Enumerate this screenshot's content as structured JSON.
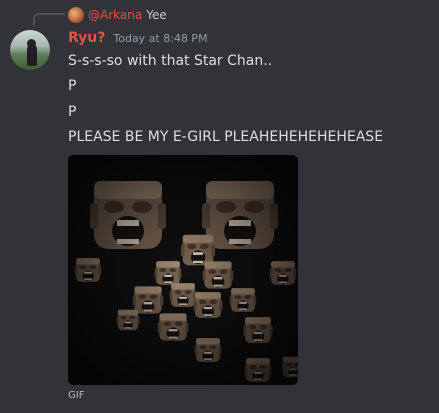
{
  "reply": {
    "author": "@Arkana",
    "text": "Yee"
  },
  "message": {
    "author": "Ryu?",
    "timestamp": "Today at 8:48 PM",
    "lines": [
      "S-s-s-so with that Star Chan..",
      "P",
      "P",
      "PLEASE BE MY E-GIRL PLEAHEHEHEHEHEASE"
    ]
  },
  "attachment": {
    "label": "GIF"
  },
  "colors": {
    "background": "#313338",
    "author_color": "#e0524a",
    "text": "#dbdee1",
    "muted": "#949ba4"
  }
}
